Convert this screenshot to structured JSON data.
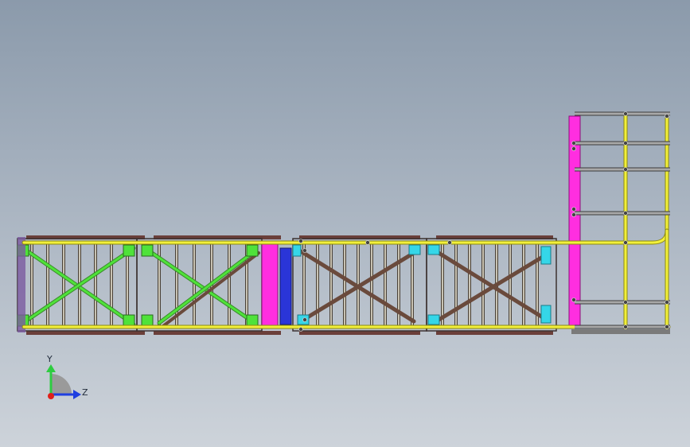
{
  "triad": {
    "y_label": "Y",
    "z_label": "Z",
    "colors": {
      "y": "#2ecc40",
      "z": "#1f3fe0",
      "x": "#e0201a",
      "cap": "#9a9a9a"
    }
  },
  "colors": {
    "background_top": "#8b9aab",
    "background_bottom": "#cdd3da",
    "rail": "#f2f03a",
    "rail_edge": "#8c8a10",
    "bracing_green": "#4fe23a",
    "bracing_brown": "#6a4a3c",
    "rung": "#a8a49a",
    "panel_dark": "#5a4a48",
    "cyan_plate": "#35d6e8",
    "magenta_plate": "#ff2ee0",
    "blue_plate": "#2a35d8",
    "grey_tube": "#9a9a9a"
  }
}
